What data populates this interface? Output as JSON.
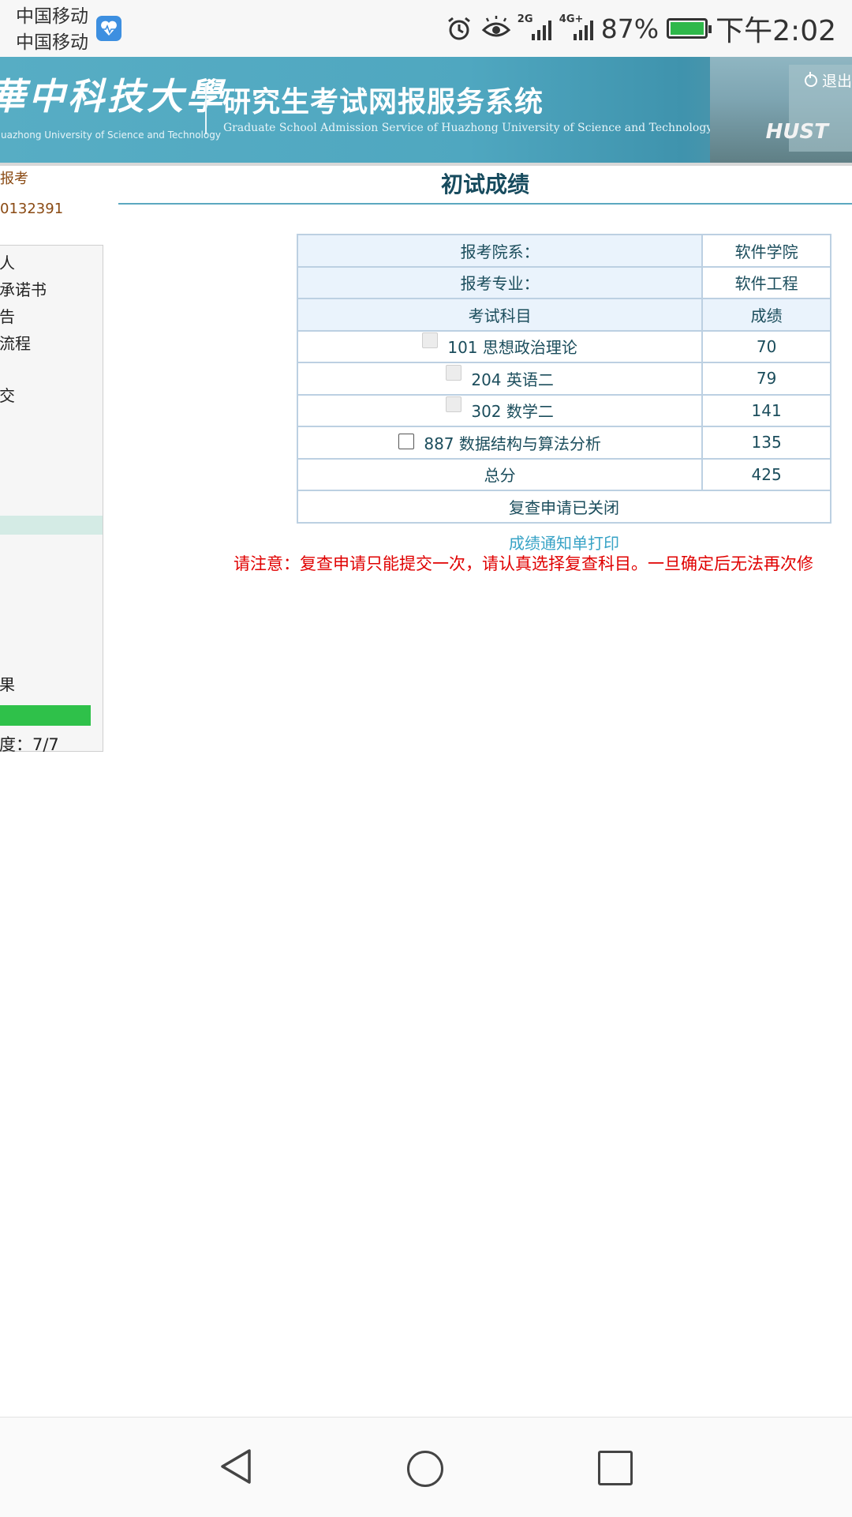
{
  "status_bar": {
    "carrier1": "中国移动",
    "carrier2": "中国移动",
    "signal1_type": "2G",
    "signal2_type": "4G+",
    "battery_percent": "87%",
    "time": "下午2:02",
    "icons": [
      "health-app-icon",
      "alarm-icon",
      "eye-comfort-icon",
      "signal-icon",
      "battery-icon"
    ]
  },
  "header": {
    "university_name": "華中科技大學",
    "university_en": "Huazhong University of Science and Technology",
    "system_title": "研究生考试网报服务系统",
    "system_en": "Graduate School Admission Service of Huazhong University of Science and Technology",
    "logout_label": "退出",
    "logo_text": "HUST"
  },
  "sidebar": {
    "top_label": "报考",
    "candidate_no": "0132391",
    "items": [
      "人",
      "承诺书",
      "告",
      "流程",
      "交"
    ],
    "result_label": "果",
    "progress_value": 1.0,
    "progress_label": "度：7/7"
  },
  "main": {
    "page_title": "初试成绩",
    "dept_label": "报考院系：",
    "dept_value": "软件学院",
    "major_label": "报考专业：",
    "major_value": "软件工程",
    "col_subject": "考试科目",
    "col_score": "成绩",
    "subjects": [
      {
        "name": "101 思想政治理论",
        "score": "70",
        "checkbox_enabled": false
      },
      {
        "name": "204 英语二",
        "score": "79",
        "checkbox_enabled": false
      },
      {
        "name": "302 数学二",
        "score": "141",
        "checkbox_enabled": false
      },
      {
        "name": "887 数据结构与算法分析",
        "score": "135",
        "checkbox_enabled": true
      }
    ],
    "total_label": "总分",
    "total_value": "425",
    "review_status": "复查申请已关闭",
    "print_link": "成绩通知单打印",
    "notice": "请注意：复查申请只能提交一次，请认真选择复查科目。一旦确定后无法再次修"
  },
  "colors": {
    "banner": "#57adc4",
    "table_border": "#bcd0e2",
    "notice_red": "#e00000",
    "progress_green": "#2fc14a"
  }
}
